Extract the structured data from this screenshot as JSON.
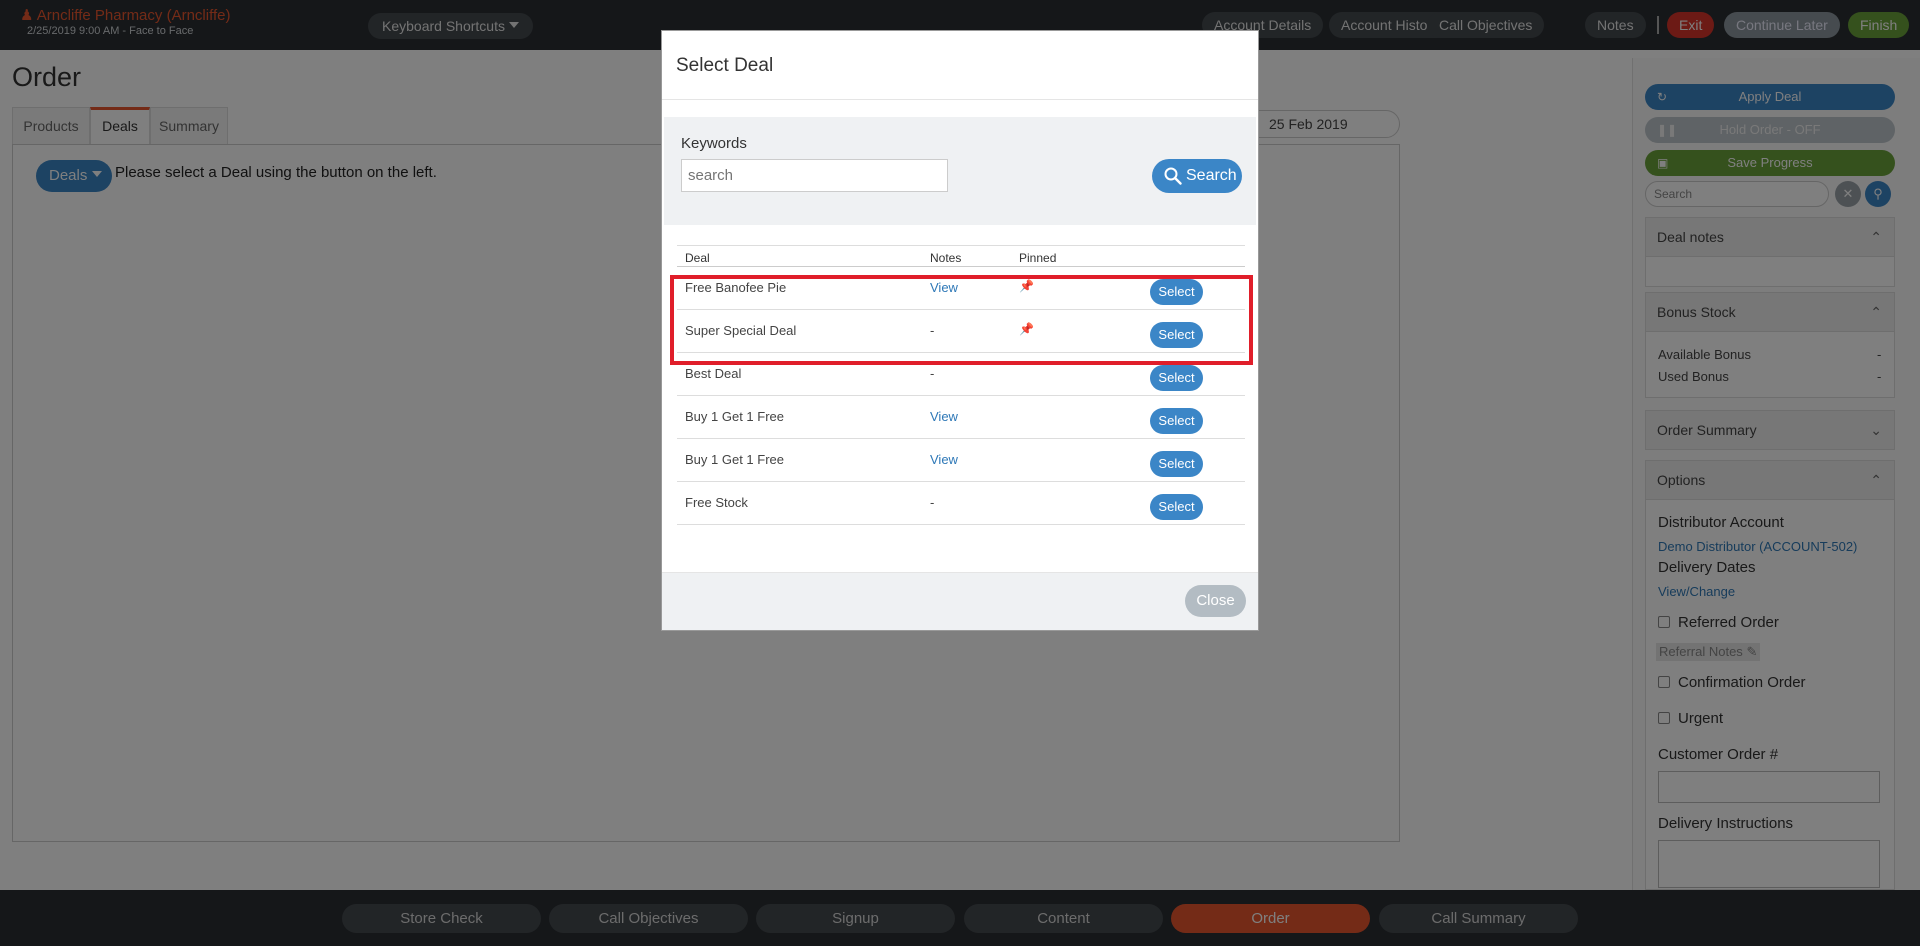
{
  "topbar": {
    "account_name": "Arncliffe Pharmacy (Arncliffe)",
    "account_sub": "2/25/2019 9:00 AM - Face to Face",
    "keyboard_shortcuts": "Keyboard Shortcuts",
    "account_details": "Account Details",
    "account_history": "Account History",
    "call_objectives": "Call Objectives",
    "notes": "Notes",
    "separator": "|",
    "exit": "Exit",
    "continue_later": "Continue Later",
    "finish": "Finish"
  },
  "page": {
    "title": "Order",
    "tabs": [
      "Products",
      "Deals",
      "Summary"
    ],
    "date": "25 Feb 2019",
    "deals_button": "Deals",
    "deals_message": "Please select a Deal using the button on the left."
  },
  "sidebar": {
    "apply_deal": "Apply Deal",
    "hold_order": "Hold Order - OFF",
    "save_progress": "Save Progress",
    "search_placeholder": "Search",
    "deal_notes": "Deal notes",
    "bonus_stock": "Bonus Stock",
    "available_bonus_label": "Available Bonus",
    "available_bonus_value": "-",
    "used_bonus_label": "Used Bonus",
    "used_bonus_value": "-",
    "order_summary": "Order Summary",
    "options": "Options",
    "distributor_account_label": "Distributor Account",
    "distributor_account_value": "Demo Distributor (ACCOUNT-502)",
    "delivery_dates_label": "Delivery Dates",
    "delivery_dates_link": "View/Change",
    "referred_order": "Referred Order",
    "referral_notes": "Referral Notes",
    "confirmation_order": "Confirmation Order",
    "urgent": "Urgent",
    "customer_order_label": "Customer Order #",
    "delivery_instructions_label": "Delivery Instructions"
  },
  "bottom_nav": [
    "Store Check",
    "Call Objectives",
    "Signup",
    "Content",
    "Order",
    "Call Summary"
  ],
  "bottom_nav_active": "Order",
  "modal": {
    "title": "Select Deal",
    "keywords_label": "Keywords",
    "search_placeholder": "search",
    "search_button": "Search",
    "columns": {
      "deal": "Deal",
      "notes": "Notes",
      "pinned": "Pinned"
    },
    "rows": [
      {
        "deal": "Free Banofee Pie",
        "notes": "View",
        "pinned": true,
        "select": "Select"
      },
      {
        "deal": "Super Special Deal",
        "notes": "-",
        "pinned": true,
        "select": "Select"
      },
      {
        "deal": "Best Deal",
        "notes": "-",
        "pinned": false,
        "select": "Select"
      },
      {
        "deal": "Buy 1 Get 1 Free",
        "notes": "View",
        "pinned": false,
        "select": "Select"
      },
      {
        "deal": "Buy 1 Get 1 Free",
        "notes": "View",
        "pinned": false,
        "select": "Select"
      },
      {
        "deal": "Free Stock",
        "notes": "-",
        "pinned": false,
        "select": "Select"
      }
    ],
    "close_button": "Close"
  },
  "colors": {
    "accent_orange": "#e8562e",
    "primary_blue": "#3b86c7",
    "success_green": "#6ba23a",
    "danger_red": "#d9342b",
    "highlight_red": "#e01e2a",
    "dark_bar": "#2b2f33"
  },
  "icons": {
    "account": "user-icon",
    "pin": "pin-icon",
    "search": "search-icon",
    "refresh": "refresh-icon",
    "pause": "pause-icon",
    "save": "save-icon",
    "chevron_up": "chevron-up-icon",
    "chevron_down": "chevron-down-icon",
    "clear": "clear-icon",
    "edit": "edit-icon"
  }
}
